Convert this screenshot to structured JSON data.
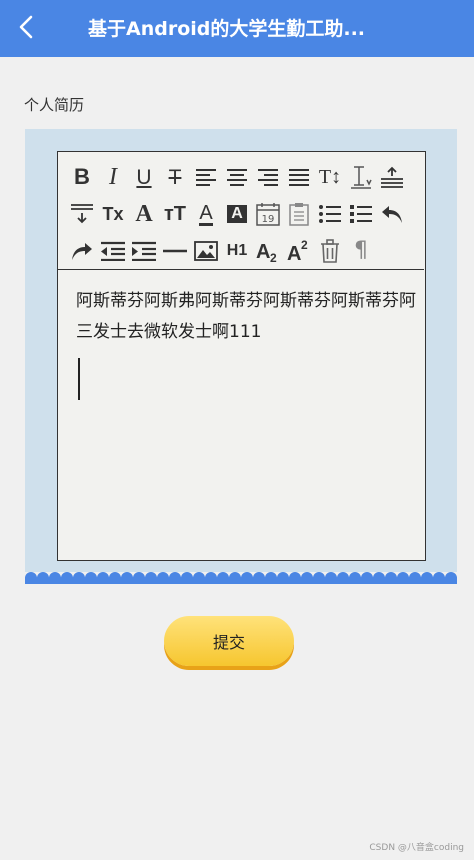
{
  "header": {
    "title": "基于Android的大学生勤工助..."
  },
  "section": {
    "label": "个人简历"
  },
  "editor": {
    "content": "阿斯蒂芬阿斯弗阿斯蒂芬阿斯蒂芬阿斯蒂芬阿三发士去微软发士啊111",
    "toolbar": [
      {
        "name": "bold",
        "glyph": "B"
      },
      {
        "name": "italic",
        "glyph": "I"
      },
      {
        "name": "underline",
        "glyph": "U"
      },
      {
        "name": "strikethrough",
        "glyph": "T"
      },
      {
        "name": "align-left-icon"
      },
      {
        "name": "align-center-icon"
      },
      {
        "name": "align-right-icon"
      },
      {
        "name": "align-justify-icon"
      },
      {
        "name": "text-size-icon",
        "glyph": "T↕"
      },
      {
        "name": "line-height-icon"
      },
      {
        "name": "heading-up-icon"
      },
      {
        "name": "heading-down-icon"
      },
      {
        "name": "clear-format",
        "glyph": "Tx"
      },
      {
        "name": "font-family",
        "glyph": "A"
      },
      {
        "name": "font-size",
        "glyph": "тT"
      },
      {
        "name": "font-color",
        "glyph": "A"
      },
      {
        "name": "background-color",
        "glyph": "A"
      },
      {
        "name": "insert-date-icon",
        "glyph": "19"
      },
      {
        "name": "clipboard-icon"
      },
      {
        "name": "ordered-list-icon"
      },
      {
        "name": "unordered-list-icon"
      },
      {
        "name": "undo-icon"
      },
      {
        "name": "redo-icon"
      },
      {
        "name": "outdent-icon"
      },
      {
        "name": "indent-icon"
      },
      {
        "name": "horizontal-rule-icon"
      },
      {
        "name": "insert-image-icon"
      },
      {
        "name": "heading1",
        "glyph": "H1"
      },
      {
        "name": "subscript",
        "glyph": "A2"
      },
      {
        "name": "superscript",
        "glyph": "A2"
      },
      {
        "name": "trash-icon"
      },
      {
        "name": "paragraph-icon",
        "glyph": "¶"
      }
    ]
  },
  "submit": {
    "label": "提交"
  },
  "footer": {
    "watermark": "CSDN @八音盒coding"
  }
}
